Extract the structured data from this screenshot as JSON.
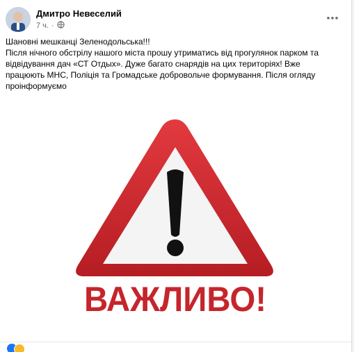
{
  "post": {
    "author": "Дмитро Невеселий",
    "time": "7 ч.",
    "lines": [
      "Шановні мешканці Зеленодольська!!!",
      "Після нічного обстрілу нашого міста прошу утриматись від прогулянок парком та відвідування дач «СТ Отдых». Дуже багато снарядів на цих територіях! Вже працюють МНС, Поліція та Громадське добровольче формування. Після огляду проінформуємо"
    ]
  },
  "image": {
    "caption": "ВАЖЛИВО!",
    "colors": {
      "red": "#d3272d",
      "dark_red": "#a31a1f",
      "inner": "#f4f4f4",
      "mark": "#111111"
    }
  },
  "icons": {
    "more": "more-horizontal-icon",
    "audience": "globe-icon",
    "reaction_like": "like-reaction-icon",
    "reaction_haha": "haha-reaction-icon"
  }
}
